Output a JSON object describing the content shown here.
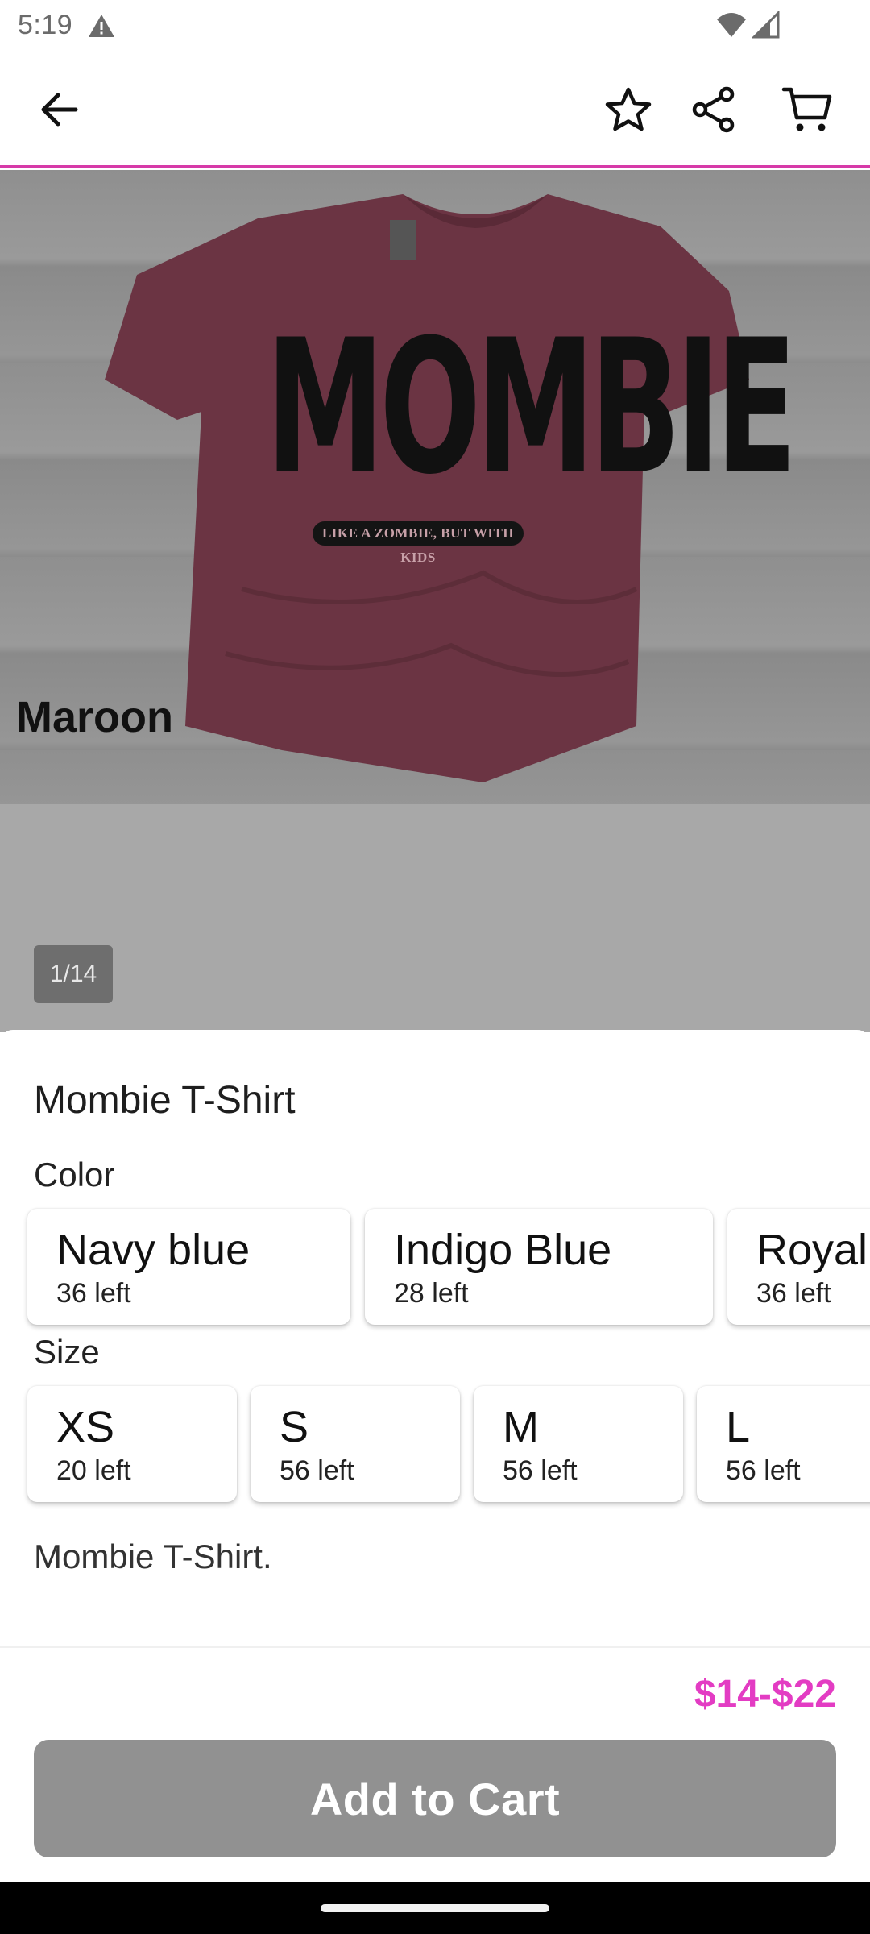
{
  "status_bar": {
    "time": "5:19"
  },
  "top_bar": {
    "back_icon": "arrow-back-icon",
    "favorite_icon": "star-outline-icon",
    "share_icon": "share-icon",
    "cart_icon": "cart-icon",
    "accent_color": "#d63aa8"
  },
  "gallery": {
    "shirt_text": "MOMBIE",
    "shirt_subtext": "LIKE A ZOMBIE, BUT WITH KIDS",
    "caption": "Maroon",
    "page_indicator": "1/14",
    "shirt_color": "#6b3443"
  },
  "product": {
    "title": "Mombie T-Shirt",
    "color_label": "Color",
    "colors": [
      {
        "name": "Navy blue",
        "stock": "36 left"
      },
      {
        "name": "Indigo Blue",
        "stock": "28 left"
      },
      {
        "name": "Royal",
        "stock": "36 left"
      }
    ],
    "size_label": "Size",
    "sizes": [
      {
        "name": "XS",
        "stock": "20 left"
      },
      {
        "name": "S",
        "stock": "56 left"
      },
      {
        "name": "M",
        "stock": "56 left"
      },
      {
        "name": "L",
        "stock": "56 left"
      }
    ],
    "description": "Mombie T-Shirt."
  },
  "footer": {
    "price": "$14-$22",
    "price_color": "#e33cc3",
    "add_to_cart_label": "Add to Cart"
  }
}
